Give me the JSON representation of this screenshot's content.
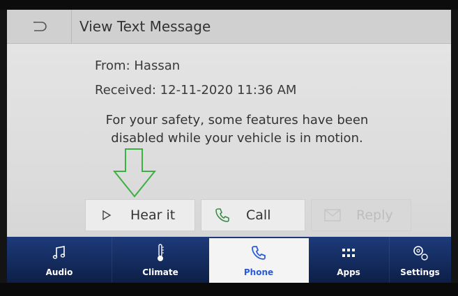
{
  "header": {
    "title": "View Text Message",
    "back_icon": "back-arrow-icon"
  },
  "message": {
    "from": "From: Hassan",
    "received": "Received: 12-11-2020 11:36 AM",
    "warning_line1": "For your safety, some features have been",
    "warning_line2": "disabled while your vehicle is in motion."
  },
  "actions": {
    "hear_label": "Hear it",
    "call_label": "Call",
    "reply_label": "Reply"
  },
  "nav": {
    "audio": "Audio",
    "climate": "Climate",
    "phone": "Phone",
    "apps": "Apps",
    "settings": "Settings"
  },
  "colors": {
    "nav_bg": "#132a5c",
    "active_tab_bg": "#f4f4f4",
    "active_tab_text": "#2a5bd7",
    "call_icon": "#3c8a4a",
    "annotation_arrow": "#3cb043"
  }
}
